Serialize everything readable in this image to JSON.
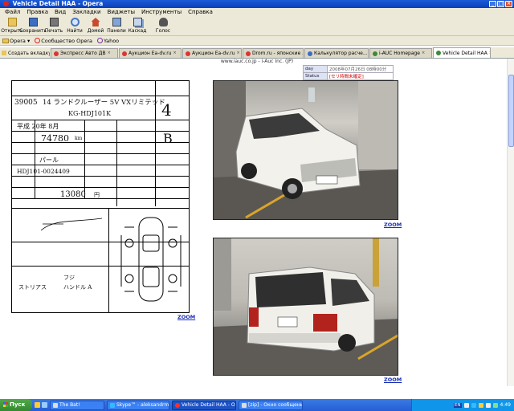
{
  "window": {
    "title": "Vehicle Detail HAA - Opera"
  },
  "menu": [
    "Файл",
    "Правка",
    "Вид",
    "Закладки",
    "Виджеты",
    "Инструменты",
    "Справка"
  ],
  "toolbar": [
    "Открыть",
    "Сохранить",
    "Печать",
    "Найти",
    "Домой",
    "Панели",
    "Каскад",
    "Голос"
  ],
  "personal_bar": [
    "Opera",
    "Сообщество Opera",
    "Yahoo"
  ],
  "tabs": {
    "new_tab": "Создать вкладку",
    "items": [
      "Экспресс Авто ДВ",
      "Аукцион Ea-dv.ru",
      "Аукцион Ea-dv.ru",
      "Drom.ru - японские ...",
      "Калькулятор расче...",
      "i-AUC Homepage",
      "Vehicle Detail HAA"
    ],
    "active_index": 6
  },
  "address_line": "www.iauc.co.jp - i-Auc Inc. (JP)",
  "info_table": [
    {
      "key": "day",
      "value": "2008年07月26日 08時00分",
      "red": false
    },
    {
      "key": "Status",
      "value": "[セリ時間未確定]",
      "red": true
    }
  ],
  "auction_sheet": {
    "lot": "39005",
    "model": "14 ランドクルーザー 5V VXリミテッド",
    "grade_box": "4",
    "chassis_code": "KG-HDJ101K",
    "year": "平成 20年 8月",
    "mileage": "74780",
    "mileage_unit": "km",
    "color": "パール",
    "score_box": "B",
    "frame_no": "HDJ101-0024409",
    "recycle_fee": "13080",
    "recycle_unit": "円",
    "notes": [
      "フジ",
      "ストリアス",
      "ハンドル A"
    ]
  },
  "zoom_label": "ZOOM",
  "taskbar": {
    "start": "Пуск",
    "tasks": [
      "The Bat!",
      "Skype™ - aleksandrmurt...",
      "Vehicle Detail HAA - O...",
      "[zip] - Окно сообщений ..."
    ],
    "active_index": 2,
    "lang": "EN",
    "clock": "4:49"
  }
}
